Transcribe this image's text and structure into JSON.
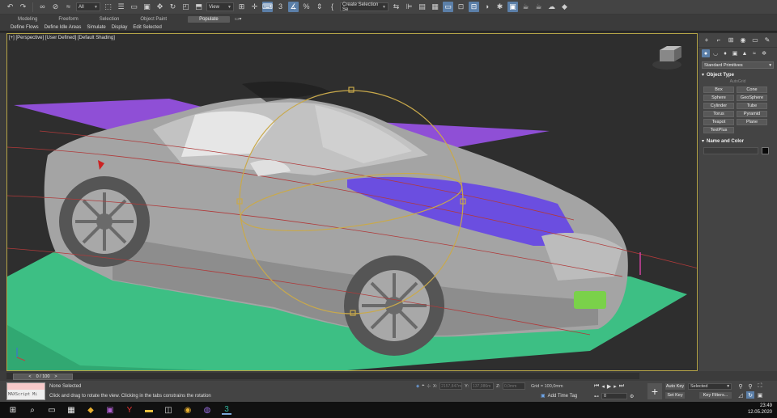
{
  "toolbar": {
    "selection_filter": "All",
    "ref_coord": "View",
    "selection_set_placeholder": "Create Selection Se",
    "snap_label": "3",
    "angle_snap_label": "%"
  },
  "ribbon": {
    "tabs": [
      "Modeling",
      "Freeform",
      "Selection",
      "Object Paint",
      "Populate"
    ],
    "subtabs": [
      "Define Flows",
      "Define Idle Areas",
      "Simulate",
      "Display",
      "Edit Selected"
    ]
  },
  "viewport": {
    "label": "[+] [Perspective] [User Defined] [Default Shading]",
    "colors": {
      "ground_plane": "#3dbf84",
      "purple_plane": "#8f4fd6",
      "car_body": "#a4a4a4",
      "gizmo": "#c9a94b"
    }
  },
  "command_panel": {
    "primitive_type": "Standard Primitives",
    "object_type_title": "Object Type",
    "autogrid_label": "AutoGrid",
    "buttons": [
      "Box",
      "Cone",
      "Sphere",
      "GeoSphere",
      "Cylinder",
      "Tube",
      "Torus",
      "Pyramid",
      "Teapot",
      "Plane",
      "TextPlus"
    ],
    "name_color_title": "Name and Color"
  },
  "timeline": {
    "frame_counter": "0 / 100"
  },
  "status": {
    "maxscript_label": "MAXScript Mi",
    "selection_status": "None Selected",
    "hint": "Click and drag to rotate the view.  Clicking in the tabs constrains the rotation",
    "x_label": "X:",
    "x_value": "2157,847m",
    "y_label": "Y:",
    "y_value": "137,086m",
    "z_label": "Z:",
    "z_value": "0,0mm",
    "grid": "Grid = 100,0mm",
    "add_time_tag": "Add Time Tag",
    "current_frame": "0",
    "auto_key": "Auto Key",
    "set_key": "Set Key",
    "selected_dropdown": "Selected",
    "key_filters": "Key Filters..."
  },
  "taskbar": {
    "time": "23:49",
    "date": "12.05.2020"
  }
}
